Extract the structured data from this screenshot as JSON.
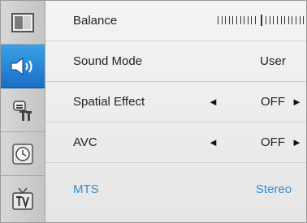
{
  "sidebar": {
    "items": [
      {
        "name": "picture",
        "icon": "picture-icon",
        "active": false
      },
      {
        "name": "sound",
        "icon": "speaker-icon",
        "active": true
      },
      {
        "name": "setup",
        "icon": "tools-icon",
        "active": false
      },
      {
        "name": "time",
        "icon": "clock-icon",
        "active": false
      },
      {
        "name": "tv",
        "icon": "tv-icon",
        "active": false
      }
    ]
  },
  "menu": {
    "balance_label": "Balance",
    "balance_level": 0.5,
    "sound_mode_label": "Sound Mode",
    "sound_mode_value": "User",
    "spatial_label": "Spatial Effect",
    "spatial_value": "OFF",
    "avc_label": "AVC",
    "avc_value": "OFF",
    "mts_label": "MTS",
    "mts_value": "Stereo",
    "arrow_left": "◄",
    "arrow_right": "►"
  },
  "colors": {
    "highlight": "#2b8ed6",
    "active_tab": "#1a6fc4"
  }
}
